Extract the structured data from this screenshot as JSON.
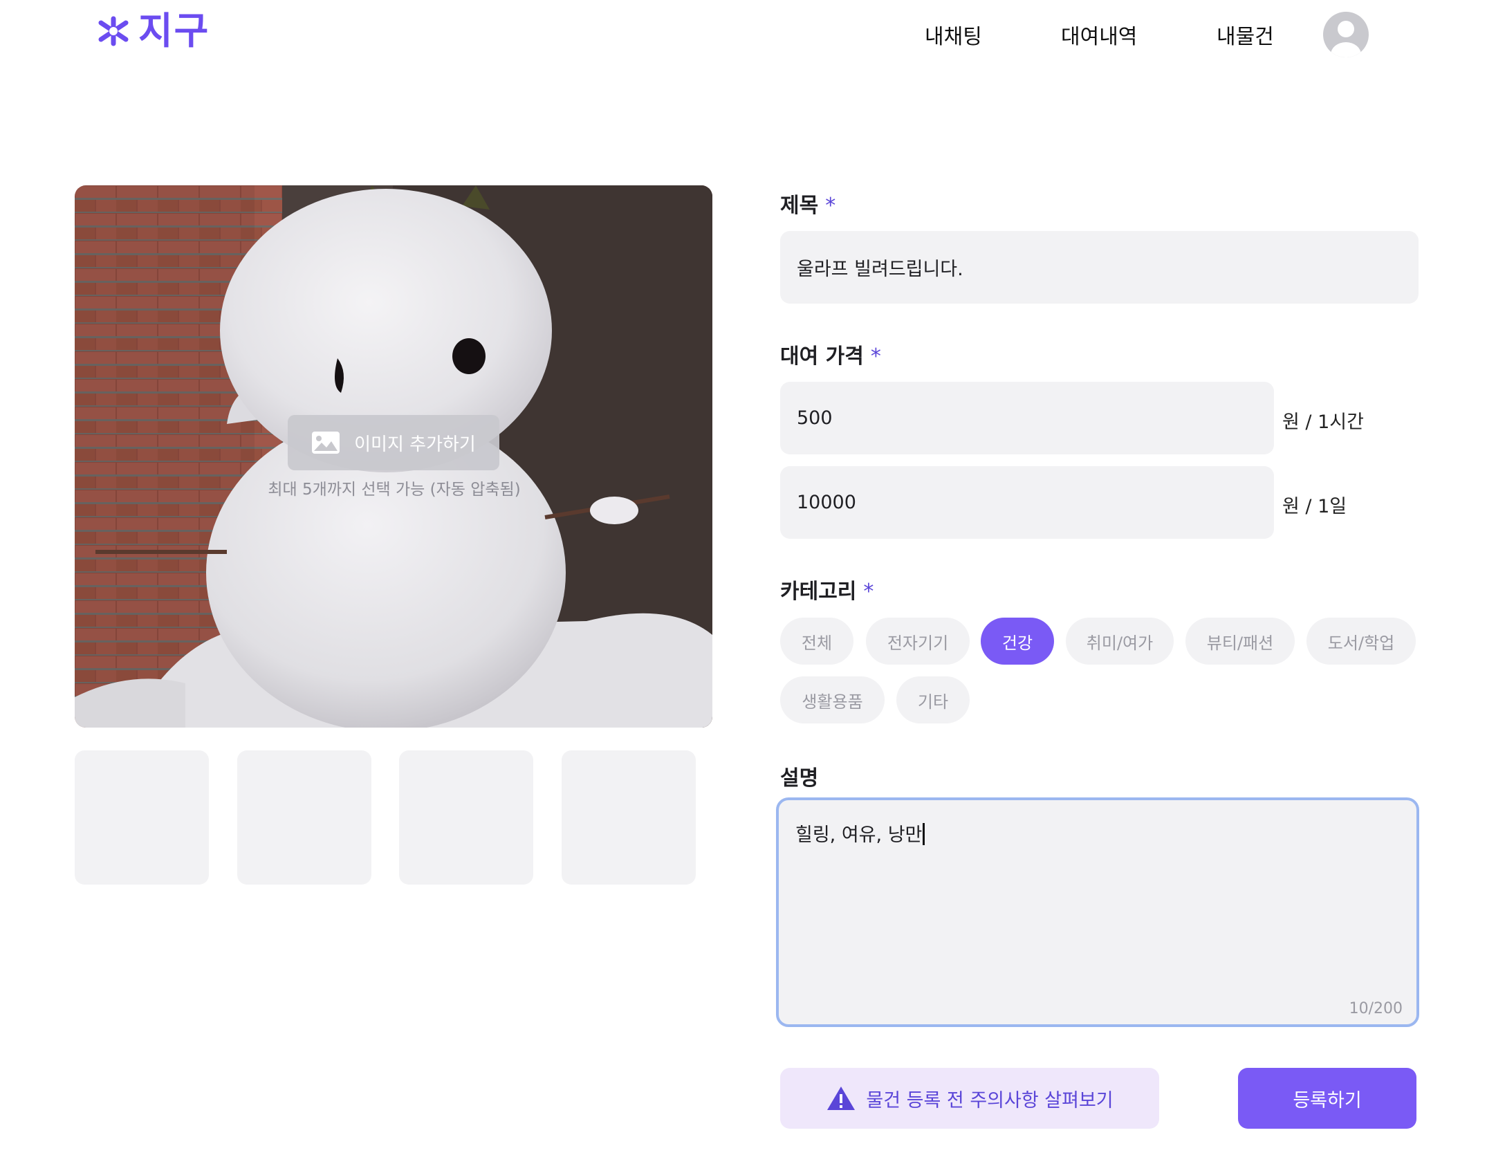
{
  "header": {
    "logo_text": "지구",
    "nav": {
      "chat": "내채팅",
      "rentals": "대여내역",
      "my_items": "내물건"
    }
  },
  "image_upload": {
    "add_button_label": "이미지 추가하기",
    "hint": "최대 5개까지 선택 가능 (자동 압축됨)"
  },
  "form": {
    "title": {
      "label": "제목",
      "required_mark": "*",
      "value": "울라프 빌려드립니다."
    },
    "price": {
      "label": "대여 가격",
      "required_mark": "*",
      "hourly_value": "500",
      "hourly_unit": "원 / 1시간",
      "daily_value": "10000",
      "daily_unit": "원 / 1일"
    },
    "category": {
      "label": "카테고리",
      "required_mark": "*",
      "options": [
        "전체",
        "전자기기",
        "건강",
        "취미/여가",
        "뷰티/패션",
        "도서/학업",
        "생활용품",
        "기타"
      ],
      "selected": "건강"
    },
    "description": {
      "label": "설명",
      "value": "힐링, 여유, 낭만",
      "counter": "10/200"
    }
  },
  "actions": {
    "warning_label": "물건 등록 전 주의사항 살펴보기",
    "submit_label": "등록하기"
  },
  "colors": {
    "accent": "#7a5af5",
    "field_bg": "#f2f2f4",
    "focus_border": "#9bb7f0"
  }
}
